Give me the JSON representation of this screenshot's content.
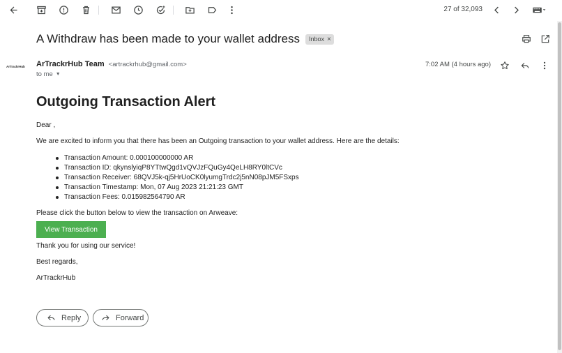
{
  "toolbar": {
    "pager_text": "27 of 32,093"
  },
  "email": {
    "subject": "A Withdraw has been made to your wallet address",
    "label": "Inbox",
    "label_close": "×",
    "avatar_text": "ArTrackrHub",
    "sender_name": "ArTrackrHub Team",
    "sender_email": "<artrackrhub@gmail.com>",
    "to_me": "to me",
    "to_me_caret": "▼",
    "time": "7:02 AM (4 hours ago)"
  },
  "message": {
    "heading": "Outgoing Transaction Alert",
    "greeting": "Dear ,",
    "intro": "We are excited to inform you that there has been an Outgoing transaction to your wallet address. Here are the details:",
    "details": [
      "Transaction Amount: 0.000100000000 AR",
      "Transaction ID: qkynslyiqP8YTtwQgd1vQVJzFQuGy4QeLH8RY0ltCVc",
      "Transaction Receiver: 68QVJ5k-qj5HrUoCK0lyumgTrdc2j5nN08pJM5FSxps",
      "Transaction Timestamp: Mon, 07 Aug 2023 21:21:23 GMT",
      "Transaction Fees: 0.015982564790 AR"
    ],
    "cta_text": "Please click the button below to view the transaction on Arweave:",
    "button_label": "View Transaction",
    "thanks": "Thank you for using our service!",
    "regards": "Best regards,",
    "signature": "ArTrackrHub"
  },
  "actions": {
    "reply": "Reply",
    "forward": "Forward"
  },
  "colors": {
    "button_green": "#4caf50",
    "label_chip": "#dddddd"
  }
}
